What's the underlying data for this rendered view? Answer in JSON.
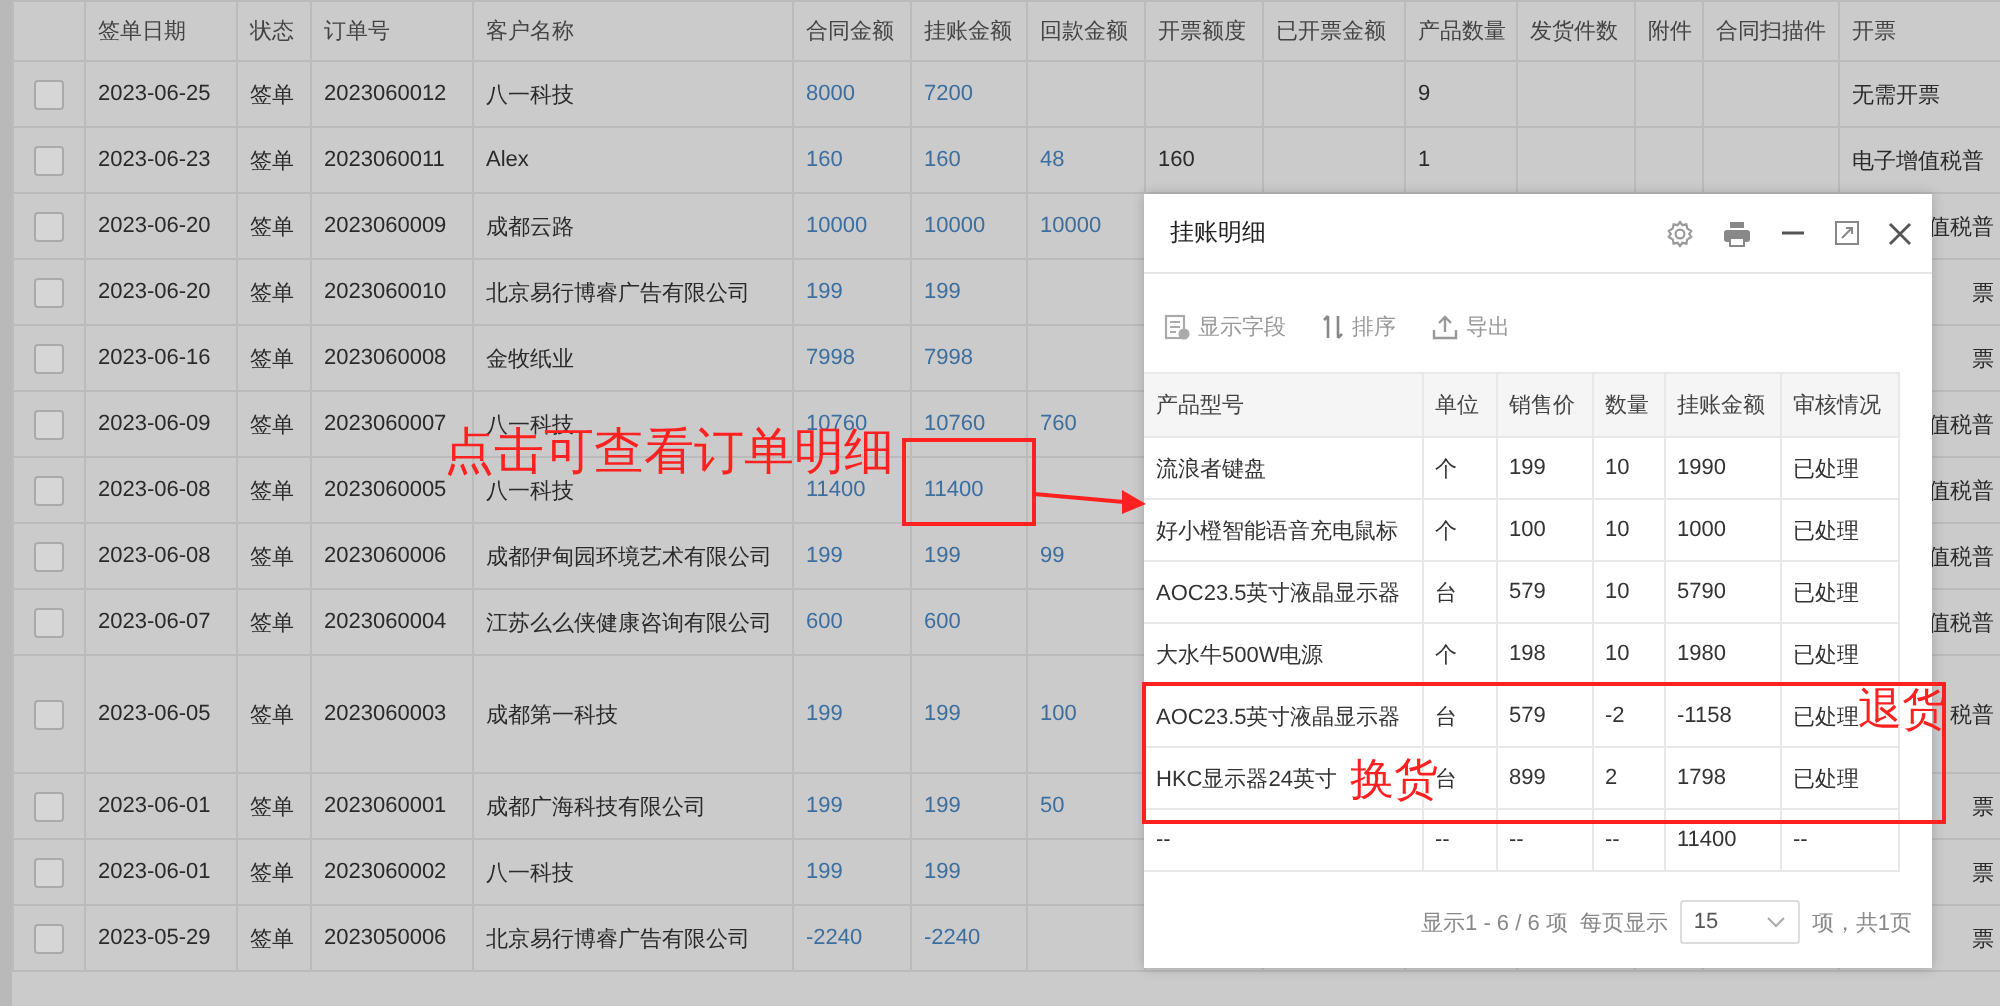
{
  "table": {
    "columns": [
      {
        "label": "签单日期",
        "kind": "text"
      },
      {
        "label": "状态",
        "kind": "text"
      },
      {
        "label": "订单号",
        "kind": "text"
      },
      {
        "label": "客户名称",
        "kind": "text"
      },
      {
        "label": "合同金额",
        "kind": "amount"
      },
      {
        "label": "挂账金额",
        "kind": "amount"
      },
      {
        "label": "回款金额",
        "kind": "amount"
      },
      {
        "label": "开票额度",
        "kind": "text"
      },
      {
        "label": "已开票金额",
        "kind": "text"
      },
      {
        "label": "产品数量",
        "kind": "text"
      },
      {
        "label": "发货件数",
        "kind": "text"
      },
      {
        "label": "附件",
        "kind": "text"
      },
      {
        "label": "合同扫描件",
        "kind": "text"
      },
      {
        "label": "开票",
        "kind": "text"
      }
    ],
    "rows": [
      {
        "checked": false,
        "covered": false,
        "kind": "normal",
        "cells": [
          "2023-06-25",
          "签单",
          "2023060012",
          "八一科技",
          "8000",
          "7200",
          null,
          null,
          null,
          "9",
          null,
          null,
          null,
          "无需开票"
        ]
      },
      {
        "checked": false,
        "covered": false,
        "kind": "normal",
        "cells": [
          "2023-06-23",
          "签单",
          "2023060011",
          "Alex",
          "160",
          "160",
          "48",
          "160",
          null,
          "1",
          null,
          null,
          null,
          "电子增值税普"
        ]
      },
      {
        "checked": false,
        "covered": true,
        "kind": "normal",
        "cells": [
          "2023-06-20",
          "签单",
          "2023060009",
          "成都云路",
          "10000",
          "10000",
          "10000",
          null,
          null,
          null,
          null,
          null,
          null,
          "值税普"
        ]
      },
      {
        "checked": false,
        "covered": true,
        "kind": "normal",
        "cells": [
          "2023-06-20",
          "签单",
          "2023060010",
          "北京易行博睿广告有限公司",
          "199",
          "199",
          null,
          null,
          null,
          null,
          null,
          null,
          null,
          "票"
        ]
      },
      {
        "checked": false,
        "covered": true,
        "kind": "normal",
        "cells": [
          "2023-06-16",
          "签单",
          "2023060008",
          "金牧纸业",
          "7998",
          "7998",
          null,
          null,
          null,
          null,
          null,
          null,
          null,
          "票"
        ]
      },
      {
        "checked": false,
        "covered": true,
        "kind": "normal",
        "cells": [
          "2023-06-09",
          "签单",
          "2023060007",
          "八一科技",
          "10760",
          "10760",
          "760",
          null,
          null,
          null,
          null,
          null,
          null,
          "值税普"
        ]
      },
      {
        "checked": false,
        "covered": true,
        "kind": "normal",
        "cells": [
          "2023-06-08",
          "签单",
          "2023060005",
          "八一科技",
          "11400",
          "11400",
          null,
          null,
          null,
          null,
          null,
          null,
          null,
          "值税普"
        ]
      },
      {
        "checked": false,
        "covered": true,
        "kind": "normal",
        "cells": [
          "2023-06-08",
          "签单",
          "2023060006",
          "成都伊甸园环境艺术有限公司",
          "199",
          "199",
          "99",
          null,
          null,
          null,
          null,
          null,
          null,
          "值税普"
        ]
      },
      {
        "checked": false,
        "covered": true,
        "kind": "normal",
        "cells": [
          "2023-06-07",
          "签单",
          "2023060004",
          "江苏么么侠健康咨询有限公司",
          "600",
          "600",
          null,
          null,
          null,
          null,
          null,
          null,
          null,
          "值税普"
        ]
      },
      {
        "checked": false,
        "covered": true,
        "kind": "tall",
        "cells": [
          "2023-06-05",
          "签单",
          "2023060003",
          "成都第一科技",
          "199",
          "199",
          "100",
          null,
          null,
          null,
          null,
          null,
          null,
          "税普"
        ]
      },
      {
        "checked": false,
        "covered": true,
        "kind": "normal",
        "cells": [
          "2023-06-01",
          "签单",
          "2023060001",
          "成都广海科技有限公司",
          "199",
          "199",
          "50",
          null,
          null,
          null,
          null,
          null,
          null,
          "票"
        ]
      },
      {
        "checked": false,
        "covered": true,
        "kind": "normal",
        "cells": [
          "2023-06-01",
          "签单",
          "2023060002",
          "八一科技",
          "199",
          "199",
          null,
          null,
          null,
          null,
          null,
          null,
          null,
          "票"
        ]
      },
      {
        "checked": false,
        "covered": true,
        "kind": "normal",
        "cells": [
          "2023-05-29",
          "签单",
          "2023050006",
          "北京易行博睿广告有限公司",
          "-2240",
          "-2240",
          null,
          null,
          null,
          null,
          null,
          null,
          null,
          "票"
        ]
      }
    ]
  },
  "dialog": {
    "title": "挂账明细",
    "toolbar": [
      {
        "kind": "fields",
        "label": "显示字段"
      },
      {
        "kind": "sort",
        "label": "排序"
      },
      {
        "kind": "export",
        "label": "导出"
      }
    ],
    "columns": [
      "产品型号",
      "单位",
      "销售价",
      "数量",
      "挂账金额",
      "审核情况"
    ],
    "rows": [
      [
        "流浪者键盘",
        "个",
        "199",
        "10",
        "1990",
        "已处理"
      ],
      [
        "好小橙智能语音充电鼠标",
        "个",
        "100",
        "10",
        "1000",
        "已处理"
      ],
      [
        "AOC23.5英寸液晶显示器",
        "台",
        "579",
        "10",
        "5790",
        "已处理"
      ],
      [
        "大水牛500W电源",
        "个",
        "198",
        "10",
        "1980",
        "已处理"
      ],
      [
        "AOC23.5英寸液晶显示器",
        "台",
        "579",
        "-2",
        "-1158",
        "已处理"
      ],
      [
        "HKC显示器24英寸",
        "台",
        "899",
        "2",
        "1798",
        "已处理"
      ],
      [
        "--",
        "--",
        "--",
        "--",
        "11400",
        "--"
      ]
    ],
    "footer": {
      "range": "显示1 - 6 / 6 项",
      "per_page_label": "每页显示",
      "per_page": "15",
      "pages": "项，共1页"
    }
  },
  "annotations": {
    "click_hint": "点击可查看订单明细",
    "return_label": "退货",
    "exchange_label": "换货"
  }
}
